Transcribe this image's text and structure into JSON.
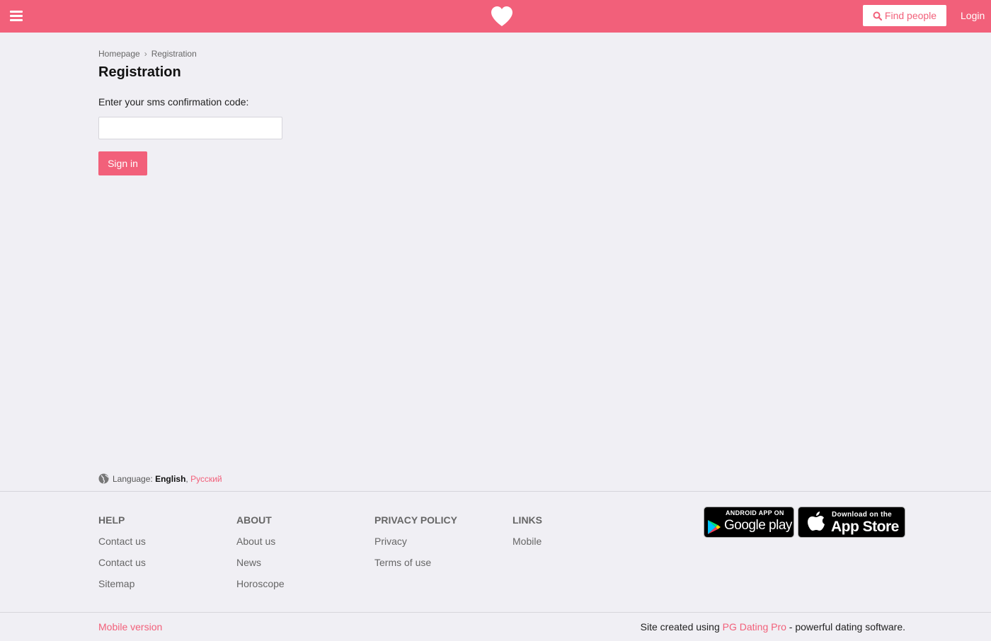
{
  "colors": {
    "brand": "#f2607a",
    "background": "#f0eff4",
    "divider": "#d6d5db"
  },
  "header": {
    "menu_icon": "hamburger-menu-icon",
    "logo_icon": "heart-icon",
    "find_people_label": "Find people",
    "find_people_icon": "search-icon",
    "login_label": "Login"
  },
  "breadcrumb": {
    "items": [
      "Homepage",
      "Registration"
    ],
    "separator_icon": "chevron-right-icon"
  },
  "page": {
    "title": "Registration",
    "code_label": "Enter your sms confirmation code:",
    "code_value": "",
    "code_placeholder": "",
    "submit_label": "Sign in"
  },
  "language": {
    "icon": "globe-icon",
    "label": "Language:",
    "current": "English",
    "separator": ",",
    "other": "Русский"
  },
  "footer": {
    "columns": [
      {
        "title": "HELP",
        "links": [
          "Contact us",
          "Contact us",
          "Sitemap"
        ]
      },
      {
        "title": "ABOUT",
        "links": [
          "About us",
          "News",
          "Horoscope"
        ]
      },
      {
        "title": "PRIVACY POLICY",
        "links": [
          "Privacy",
          "Terms of use"
        ]
      },
      {
        "title": "LINKS",
        "links": [
          "Mobile"
        ]
      }
    ],
    "google_play": {
      "line1": "ANDROID APP ON",
      "line2": "Google play",
      "icon": "google-play-icon"
    },
    "app_store": {
      "line1": "Download on the",
      "line2": "App Store",
      "icon": "apple-icon"
    },
    "mobile_version": "Mobile version",
    "credits_prefix": "Site created using",
    "credits_link": "PG Dating Pro",
    "credits_suffix": "- powerful dating software."
  }
}
